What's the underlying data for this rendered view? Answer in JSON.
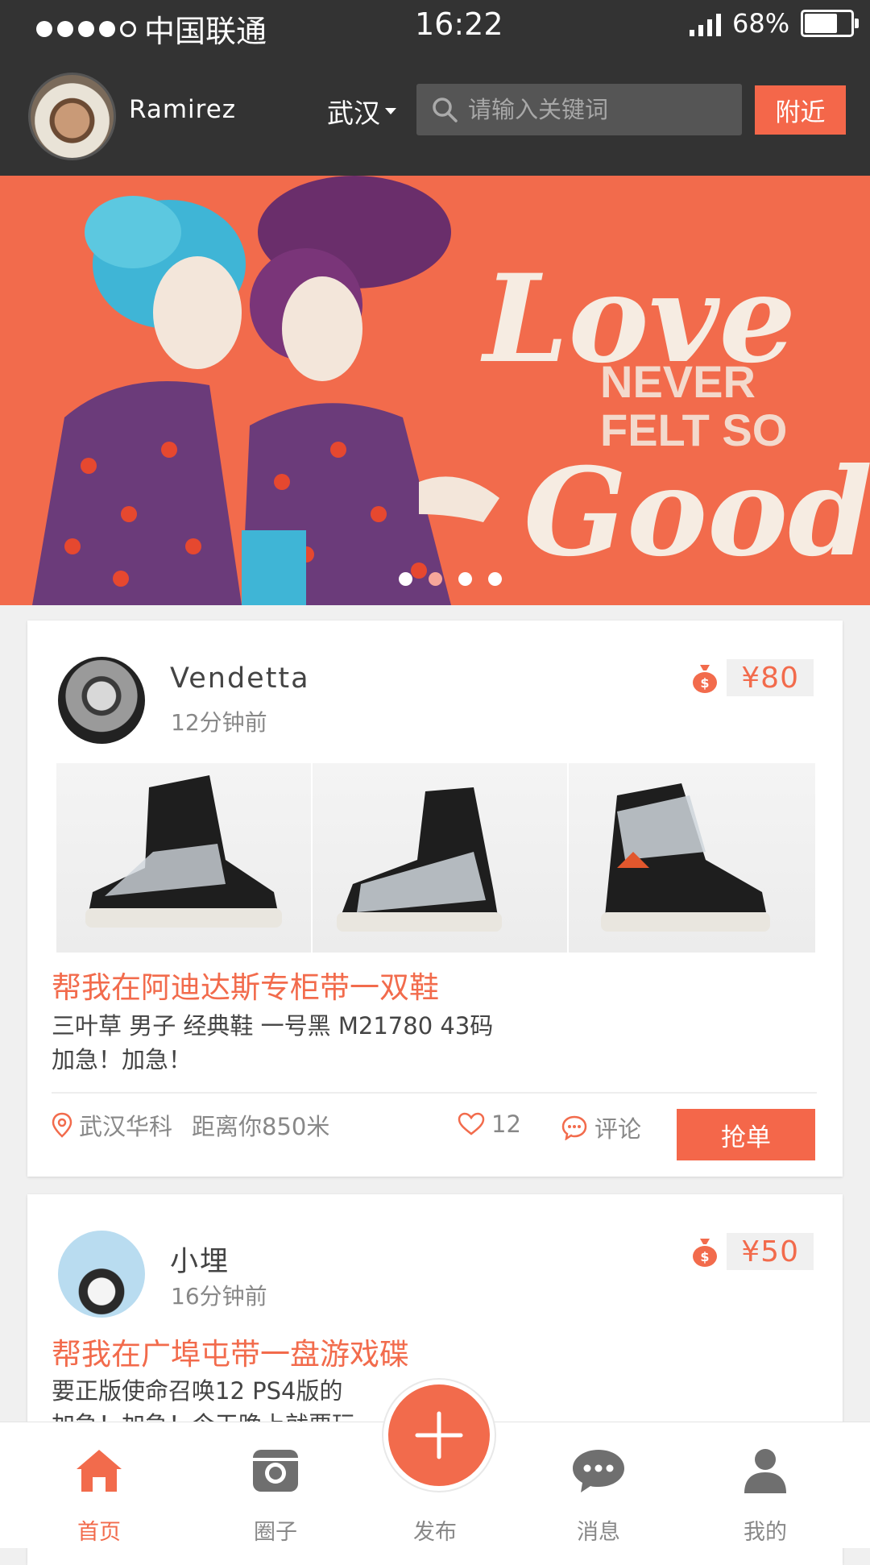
{
  "status_bar": {
    "carrier": "中国联通",
    "time": "16:22",
    "battery": "68%"
  },
  "header": {
    "username": "Ramirez",
    "city": "武汉",
    "search_placeholder": "请输入关键词",
    "nearby_label": "附近"
  },
  "banner": {
    "image_text": "Love NEVER FELT SO Good!",
    "page_count": 4,
    "active_index": 1
  },
  "posts": [
    {
      "user": "Vendetta",
      "time": "12分钟前",
      "price": "¥80",
      "title": "帮我在阿迪达斯专柜带一双鞋",
      "desc_line1": "三叶草 男子 经典鞋 一号黑 M21780 43码",
      "desc_line2": "加急！加急！",
      "location": "武汉华科",
      "distance": "距离你850米",
      "likes": "12",
      "comment_label": "评论",
      "action_label": "抢单"
    },
    {
      "user": "小埋",
      "time": "16分钟前",
      "price": "¥50",
      "title": "帮我在广埠屯带一盘游戏碟",
      "desc_line1": "要正版使命召唤12  PS4版的  ",
      "desc_line2": "加急！加急！今天晚上就要玩"
    }
  ],
  "tabbar": {
    "home": "首页",
    "circle": "圈子",
    "publish": "发布",
    "messages": "消息",
    "mine": "我的"
  },
  "colors": {
    "accent": "#f26b4c",
    "header_bg": "#333333"
  }
}
